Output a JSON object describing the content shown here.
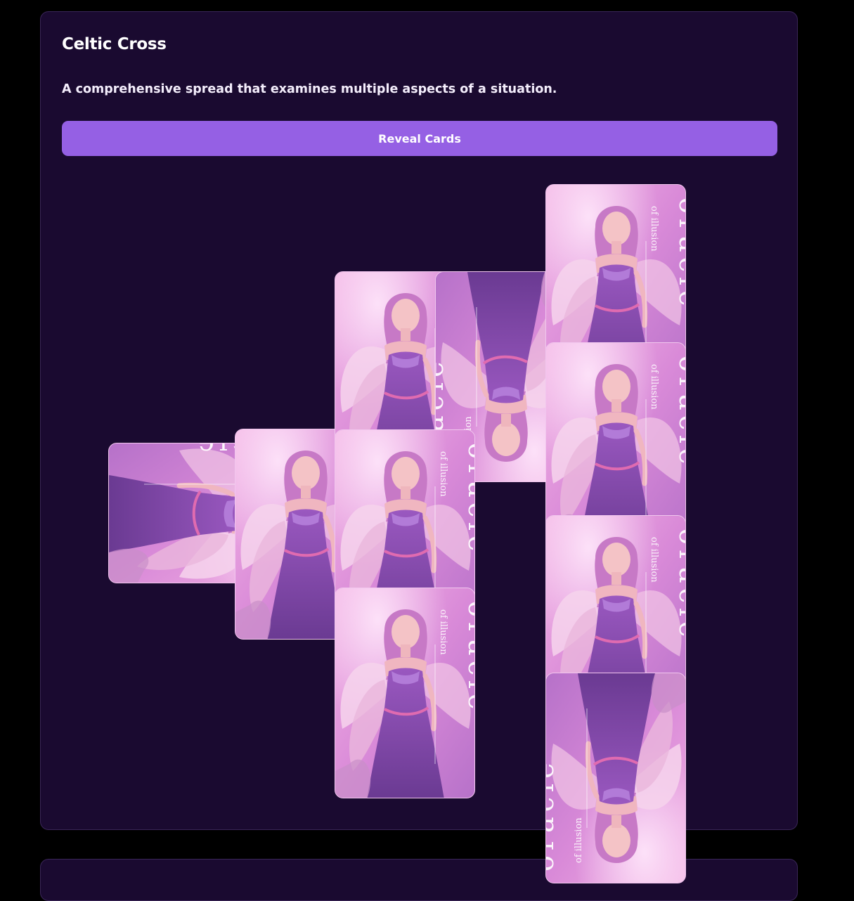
{
  "spread": {
    "title": "Celtic Cross",
    "description": "A comprehensive spread that examines multiple aspects of a situation.",
    "reveal_label": "Reveal Cards"
  },
  "card_back": {
    "brand_word": "oracle",
    "brand_sub": "of illusion",
    "art": "winged-angel-illustration"
  },
  "colors": {
    "page_bg": "#000000",
    "panel_bg": "#1a0a30",
    "panel_border": "#3a2658",
    "accent": "#9560e4",
    "card_border": "#f1c6ee"
  },
  "cards": [
    {
      "id": "cross",
      "orientation": "sideways-flipped"
    },
    {
      "id": "past",
      "orientation": "upright"
    },
    {
      "id": "crown",
      "orientation": "upright"
    },
    {
      "id": "future",
      "orientation": "reversed"
    },
    {
      "id": "present",
      "orientation": "upright"
    },
    {
      "id": "foundation",
      "orientation": "upright"
    },
    {
      "id": "outcome",
      "orientation": "upright"
    },
    {
      "id": "hopes-fears",
      "orientation": "upright"
    },
    {
      "id": "environment",
      "orientation": "upright"
    },
    {
      "id": "self",
      "orientation": "reversed"
    }
  ]
}
